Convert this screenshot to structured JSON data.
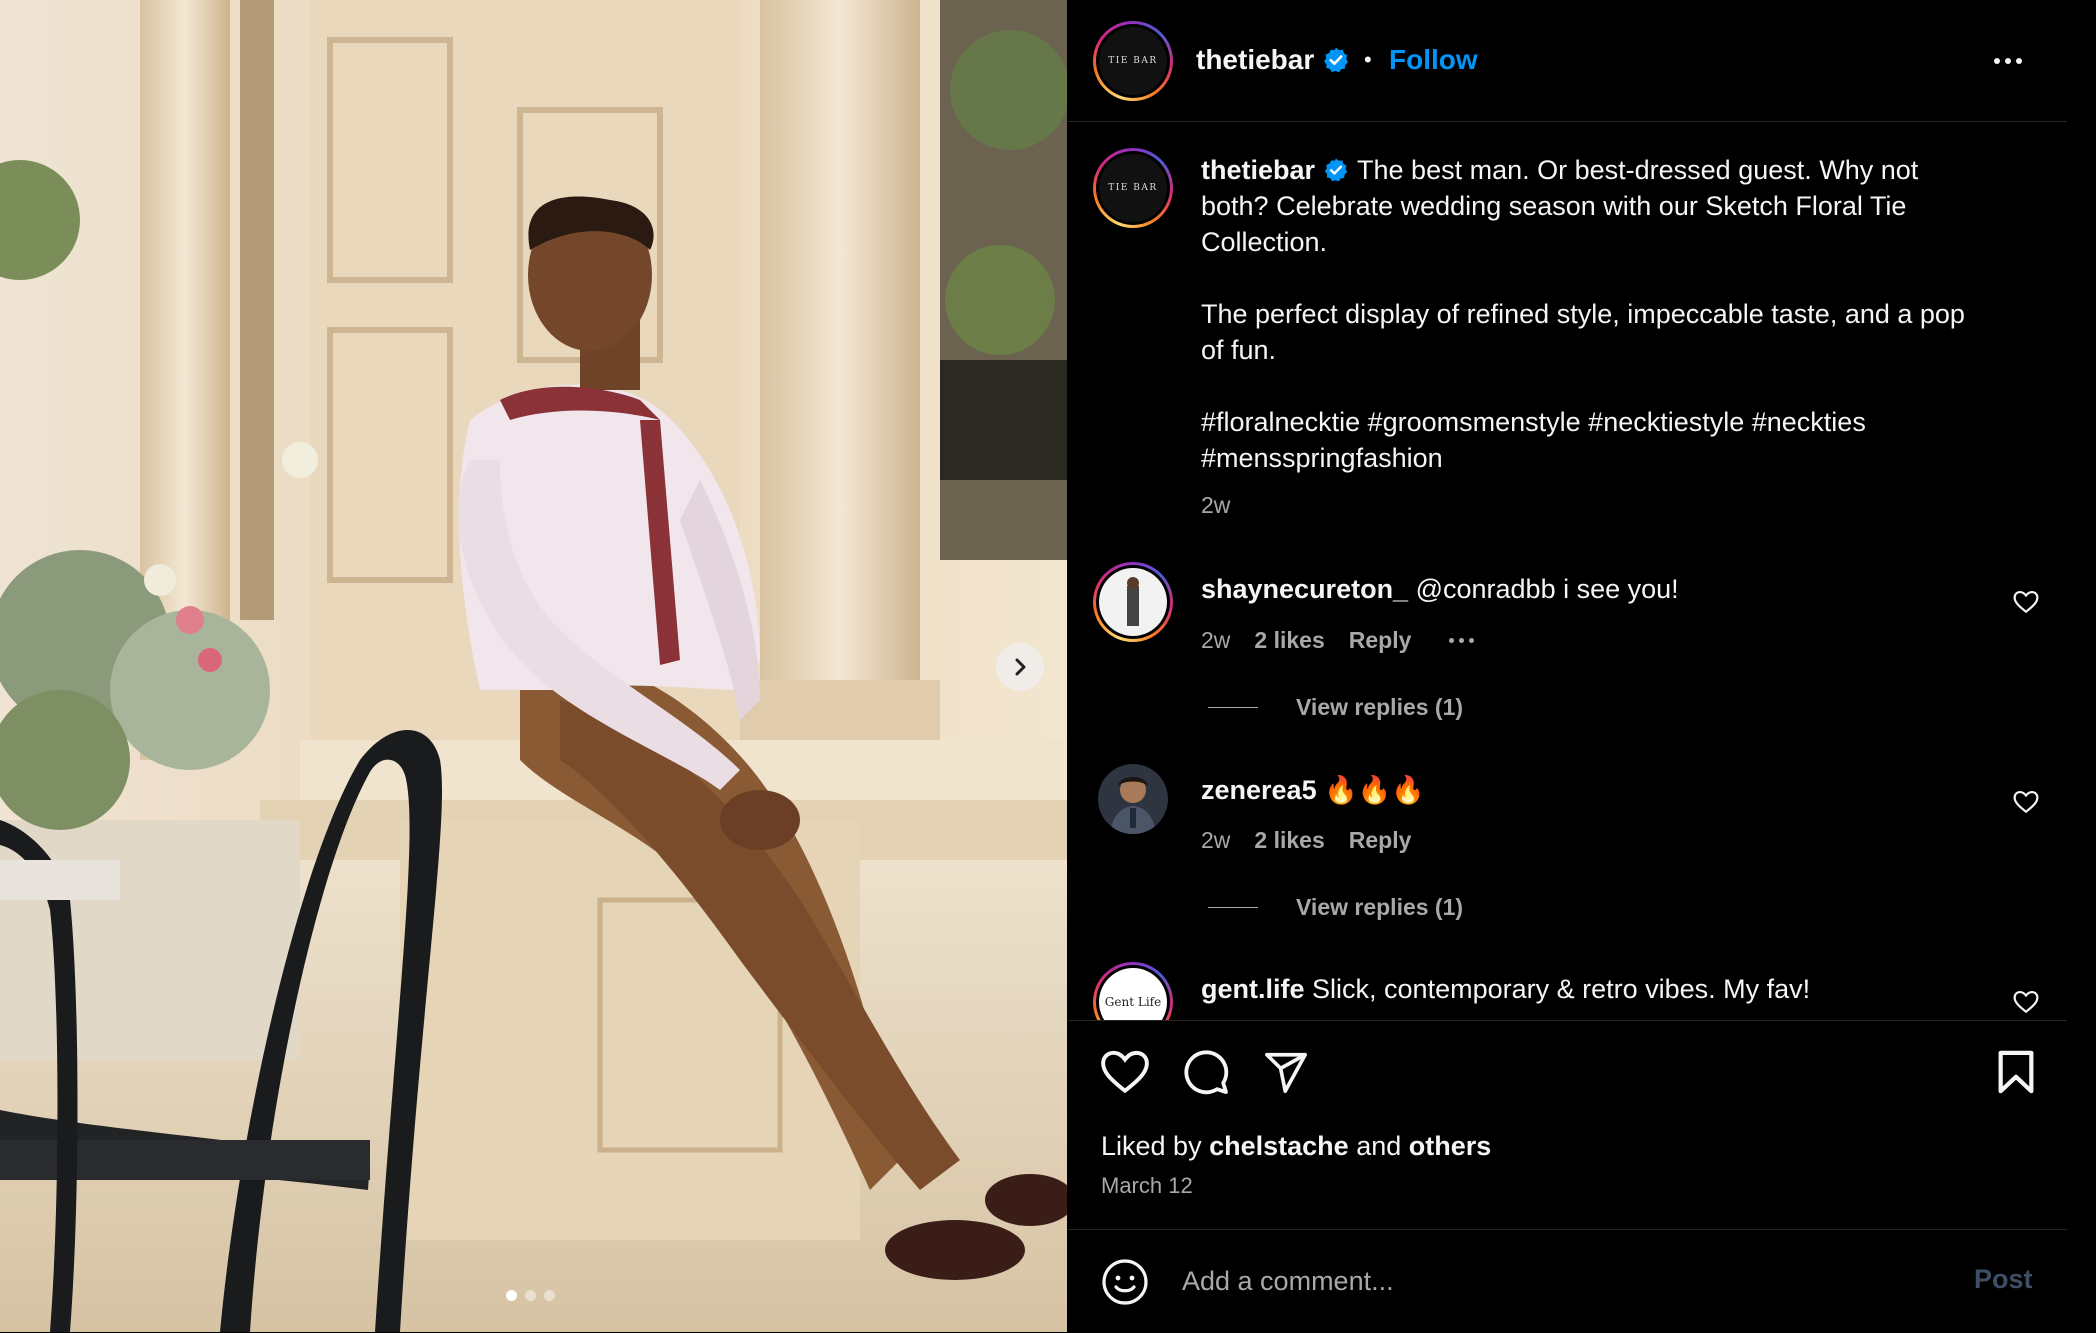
{
  "photo": {
    "alt_icon": "photo-of-man-in-tie",
    "next_icon": "chevron-right-icon",
    "carousel_dots": 3,
    "carousel_active": 1
  },
  "header": {
    "username": "thetiebar",
    "avatar_text": "TIE BAR",
    "separator": "•",
    "follow_label": "Follow",
    "more_icon": "more-horizontal-icon"
  },
  "caption": {
    "username": "thetiebar",
    "avatar_text": "TIE BAR",
    "text": "The best man. Or best-dressed guest. Why not both? Celebrate wedding season with our Sketch Floral Tie Collection.\n\nThe perfect display of refined style, impeccable taste, and a pop of fun.\n\n#floralnecktie #groomsmenstyle #necktiestyle #neckties #mensspringfashion",
    "time": "2w"
  },
  "comments": [
    {
      "username": "shaynecureton_",
      "text": "@conradbb i see you!",
      "time": "2w",
      "likes": "2 likes",
      "reply_label": "Reply",
      "view_replies": "View replies (1)"
    },
    {
      "username": "zenerea5",
      "text": "🔥🔥🔥",
      "time": "2w",
      "likes": "2 likes",
      "reply_label": "Reply",
      "view_replies": "View replies (1)"
    },
    {
      "username": "gent.life",
      "avatar_text": "Gent Life",
      "text": "Slick, contemporary & retro vibes. My fav!"
    }
  ],
  "actions": {
    "like_icon": "heart-icon",
    "comment_icon": "comment-icon",
    "share_icon": "send-icon",
    "save_icon": "bookmark-icon",
    "liked_by_prefix": "Liked by",
    "liked_by_user": "chelstache",
    "liked_by_and": "and",
    "liked_by_others": "others",
    "date": "March 12"
  },
  "add_comment": {
    "emoji_icon": "emoji-icon",
    "placeholder": "Add a comment...",
    "post_label": "Post"
  },
  "colors": {
    "accent": "#0095f6",
    "background": "#000000",
    "muted_text": "#a8a8a8",
    "post_disabled": "#3d4e66"
  }
}
